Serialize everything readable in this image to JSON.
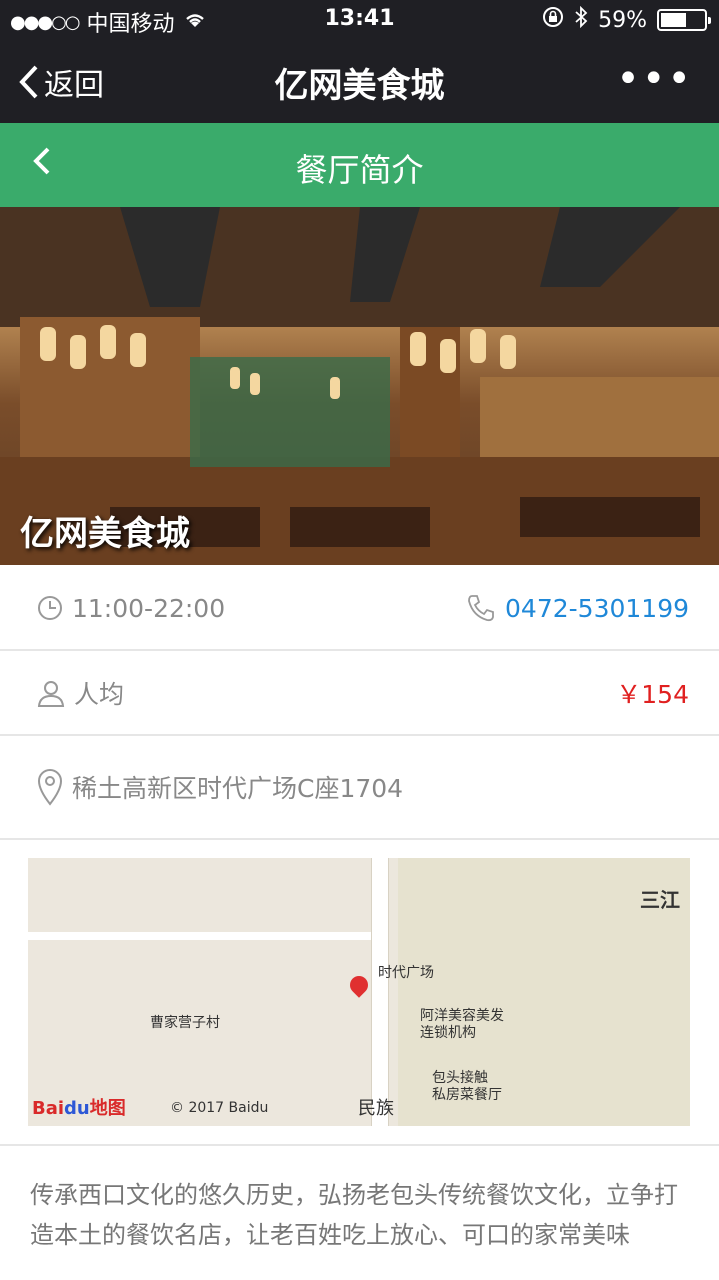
{
  "status_bar": {
    "signal": "●●●○○",
    "carrier": "中国移动",
    "time": "13:41",
    "battery_percent": "59%",
    "battery_level": 0.59
  },
  "wechat_nav": {
    "back_label": "返回",
    "title": "亿网美食城",
    "more_label": "•••"
  },
  "page_header": {
    "title": "餐厅简介"
  },
  "hero": {
    "caption": "亿网美食城"
  },
  "info": {
    "hours": "11:00-22:00",
    "phone": "0472-5301199",
    "avg_label": "人均",
    "avg_price": "￥154",
    "address": "稀土高新区时代广场C座1704"
  },
  "map": {
    "labels": {
      "poi_main": "时代广场",
      "village": "曹家营子村",
      "salon": "阿洋美容美发\n连锁机构",
      "restaurant": "包头接触\n私房菜餐厅",
      "district": "三江",
      "road": "民族"
    },
    "baidu_logo": "Baidu地图",
    "copyright": "© 2017 Baidu"
  },
  "description": "传承西口文化的悠久历史，弘扬老包头传统餐饮文化，立争打造本土的餐饮名店，让老百姓吃上放心、可口的家常美味"
}
